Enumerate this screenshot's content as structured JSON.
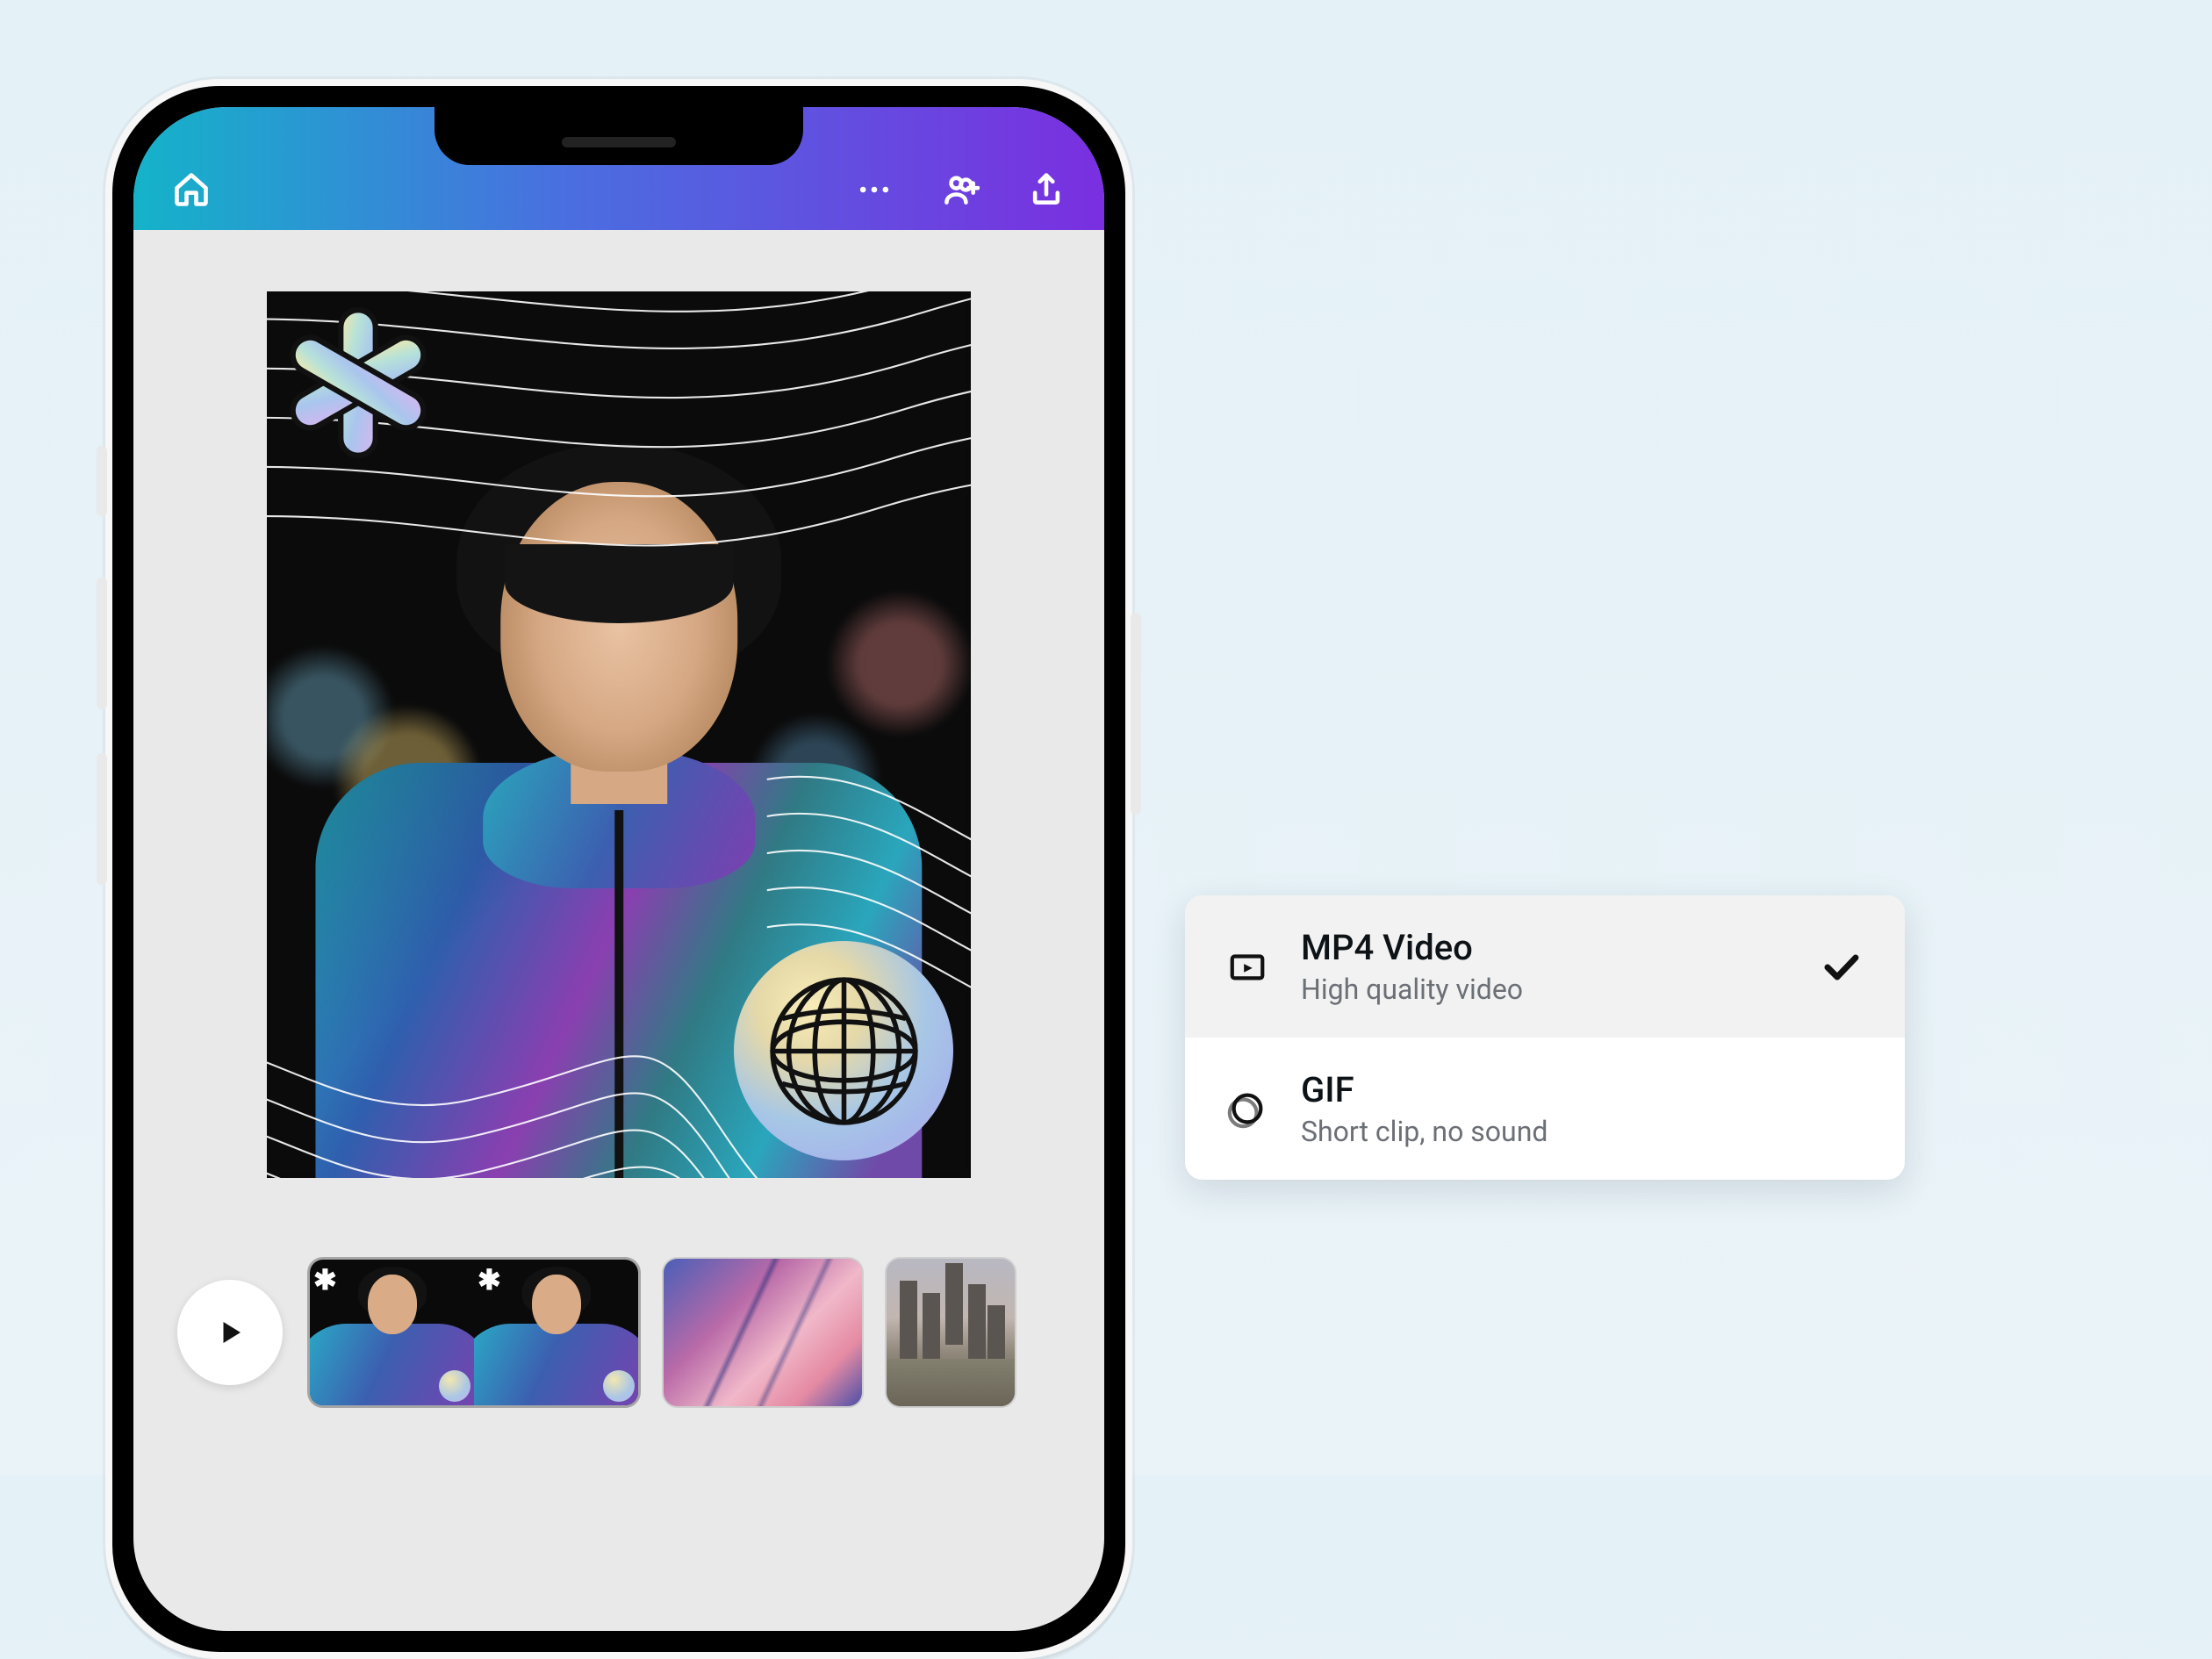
{
  "header": {
    "home_icon": "home-icon",
    "more_icon": "more-icon",
    "collaborate_icon": "collaborate-icon",
    "share_icon": "share-icon"
  },
  "canvas": {
    "description": "Portrait design with holographic jacket, white contour lines overlay, asterisk sticker top-left, globe sticker bottom-right",
    "sticker_asterisk": "asterisk-sticker",
    "sticker_globe": "globe-sticker"
  },
  "timeline": {
    "play": "Play",
    "thumbnails": [
      {
        "id": "frame-1-2",
        "selected": true
      },
      {
        "id": "frame-3",
        "selected": false
      },
      {
        "id": "frame-4",
        "selected": false
      }
    ]
  },
  "export_options": [
    {
      "id": "mp4",
      "title": "MP4 Video",
      "subtitle": "High quality video",
      "selected": true,
      "icon": "video-file-icon"
    },
    {
      "id": "gif",
      "title": "GIF",
      "subtitle": "Short clip, no sound",
      "selected": false,
      "icon": "gif-icon"
    }
  ]
}
